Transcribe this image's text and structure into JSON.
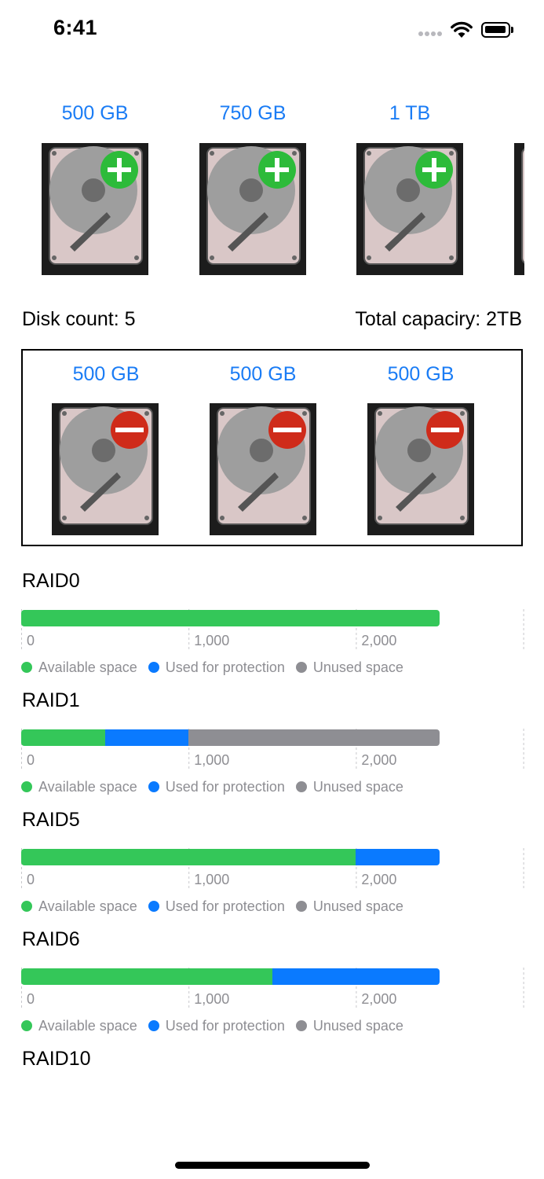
{
  "status_bar": {
    "time": "6:41"
  },
  "available_disks": [
    {
      "label": "500 GB",
      "action_icon": "add-icon"
    },
    {
      "label": "750 GB",
      "action_icon": "add-icon"
    },
    {
      "label": "1 TB",
      "action_icon": "add-icon"
    }
  ],
  "summary": {
    "disk_count": "Disk count: 5",
    "total_capacity": "Total capaciry: 2TB"
  },
  "selected_disks": [
    {
      "label": "500 GB",
      "action_icon": "remove-icon"
    },
    {
      "label": "500 GB",
      "action_icon": "remove-icon"
    },
    {
      "label": "500 GB",
      "action_icon": "remove-icon"
    }
  ],
  "colors": {
    "available": "#34c759",
    "protection": "#0a7aff",
    "unused": "#8e8e93",
    "link": "#1a7cf5"
  },
  "legend": {
    "available": "Available space",
    "protection": "Used for protection",
    "unused": "Unused space"
  },
  "chart_data": [
    {
      "type": "bar",
      "title": "RAID0",
      "xlim": [
        0,
        3000
      ],
      "ticks": [
        "0",
        "1,000",
        "2,000"
      ],
      "series": [
        {
          "name": "Available space",
          "value": 2500
        },
        {
          "name": "Used for protection",
          "value": 0
        },
        {
          "name": "Unused space",
          "value": 0
        }
      ]
    },
    {
      "type": "bar",
      "title": "RAID1",
      "xlim": [
        0,
        3000
      ],
      "ticks": [
        "0",
        "1,000",
        "2,000"
      ],
      "series": [
        {
          "name": "Available space",
          "value": 500
        },
        {
          "name": "Used for protection",
          "value": 500
        },
        {
          "name": "Unused space",
          "value": 1500
        }
      ]
    },
    {
      "type": "bar",
      "title": "RAID5",
      "xlim": [
        0,
        3000
      ],
      "ticks": [
        "0",
        "1,000",
        "2,000"
      ],
      "series": [
        {
          "name": "Available space",
          "value": 2000
        },
        {
          "name": "Used for protection",
          "value": 500
        },
        {
          "name": "Unused space",
          "value": 0
        }
      ]
    },
    {
      "type": "bar",
      "title": "RAID6",
      "xlim": [
        0,
        3000
      ],
      "ticks": [
        "0",
        "1,000",
        "2,000"
      ],
      "series": [
        {
          "name": "Available space",
          "value": 1500
        },
        {
          "name": "Used for protection",
          "value": 1000
        },
        {
          "name": "Unused space",
          "value": 0
        }
      ]
    },
    {
      "type": "bar",
      "title": "RAID10",
      "series": []
    }
  ]
}
